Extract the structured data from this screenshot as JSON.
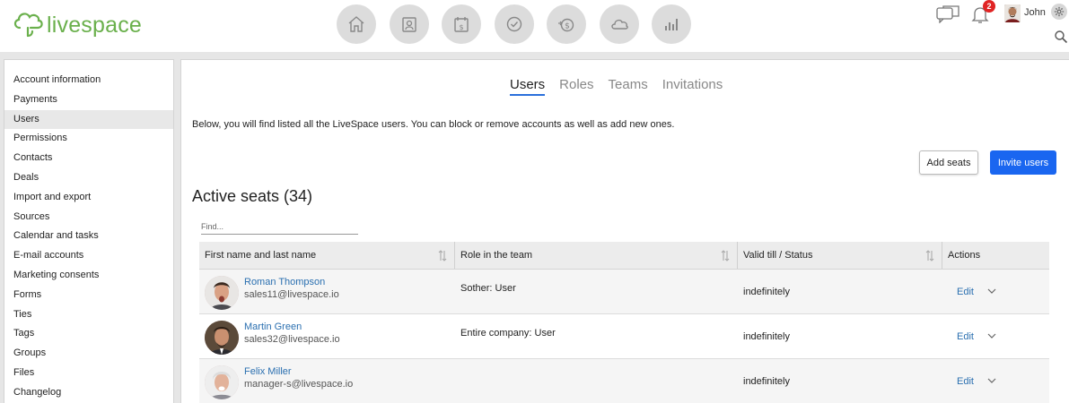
{
  "app": {
    "logo_text": "livespace",
    "brand_color": "#6ab04c",
    "accent_color": "#1a66f0",
    "nav_icons": [
      "home-icon",
      "contacts-icon",
      "calendar-icon",
      "tasks-icon",
      "deals-icon",
      "cloud-icon",
      "reports-icon"
    ]
  },
  "topright": {
    "notification_count": "2",
    "username": "John"
  },
  "sidebar": {
    "items": [
      {
        "label": "Account information"
      },
      {
        "label": "Payments"
      },
      {
        "label": "Users",
        "active": true
      },
      {
        "label": "Permissions"
      },
      {
        "label": "Contacts"
      },
      {
        "label": "Deals"
      },
      {
        "label": "Import and export"
      },
      {
        "label": "Sources"
      },
      {
        "label": "Calendar and tasks"
      },
      {
        "label": "E-mail accounts"
      },
      {
        "label": "Marketing consents"
      },
      {
        "label": "Forms"
      },
      {
        "label": "Ties"
      },
      {
        "label": "Tags"
      },
      {
        "label": "Groups"
      },
      {
        "label": "Files"
      },
      {
        "label": "Changelog"
      }
    ]
  },
  "main": {
    "tabs": [
      {
        "label": "Users",
        "active": true
      },
      {
        "label": "Roles"
      },
      {
        "label": "Teams"
      },
      {
        "label": "Invitations"
      }
    ],
    "description": "Below, you will find listed all the LiveSpace users. You can block or remove accounts as well as add new ones.",
    "add_seats_label": "Add seats",
    "invite_users_label": "Invite users",
    "section_title": "Active seats (34)",
    "find_placeholder": "Find...",
    "table": {
      "columns": [
        "First name and last name",
        "Role in the team",
        "Valid till / Status",
        "Actions"
      ],
      "rows": [
        {
          "name": "Roman Thompson",
          "email": "sales11@livespace.io",
          "role": "Sother: User",
          "valid": "indefinitely",
          "action": "Edit"
        },
        {
          "name": "Martin Green",
          "email": "sales32@livespace.io",
          "role": "Entire company: User",
          "valid": "indefinitely",
          "action": "Edit"
        },
        {
          "name": "Felix Miller",
          "email": "manager-s@livespace.io",
          "role": "",
          "valid": "indefinitely",
          "action": "Edit"
        }
      ]
    }
  }
}
